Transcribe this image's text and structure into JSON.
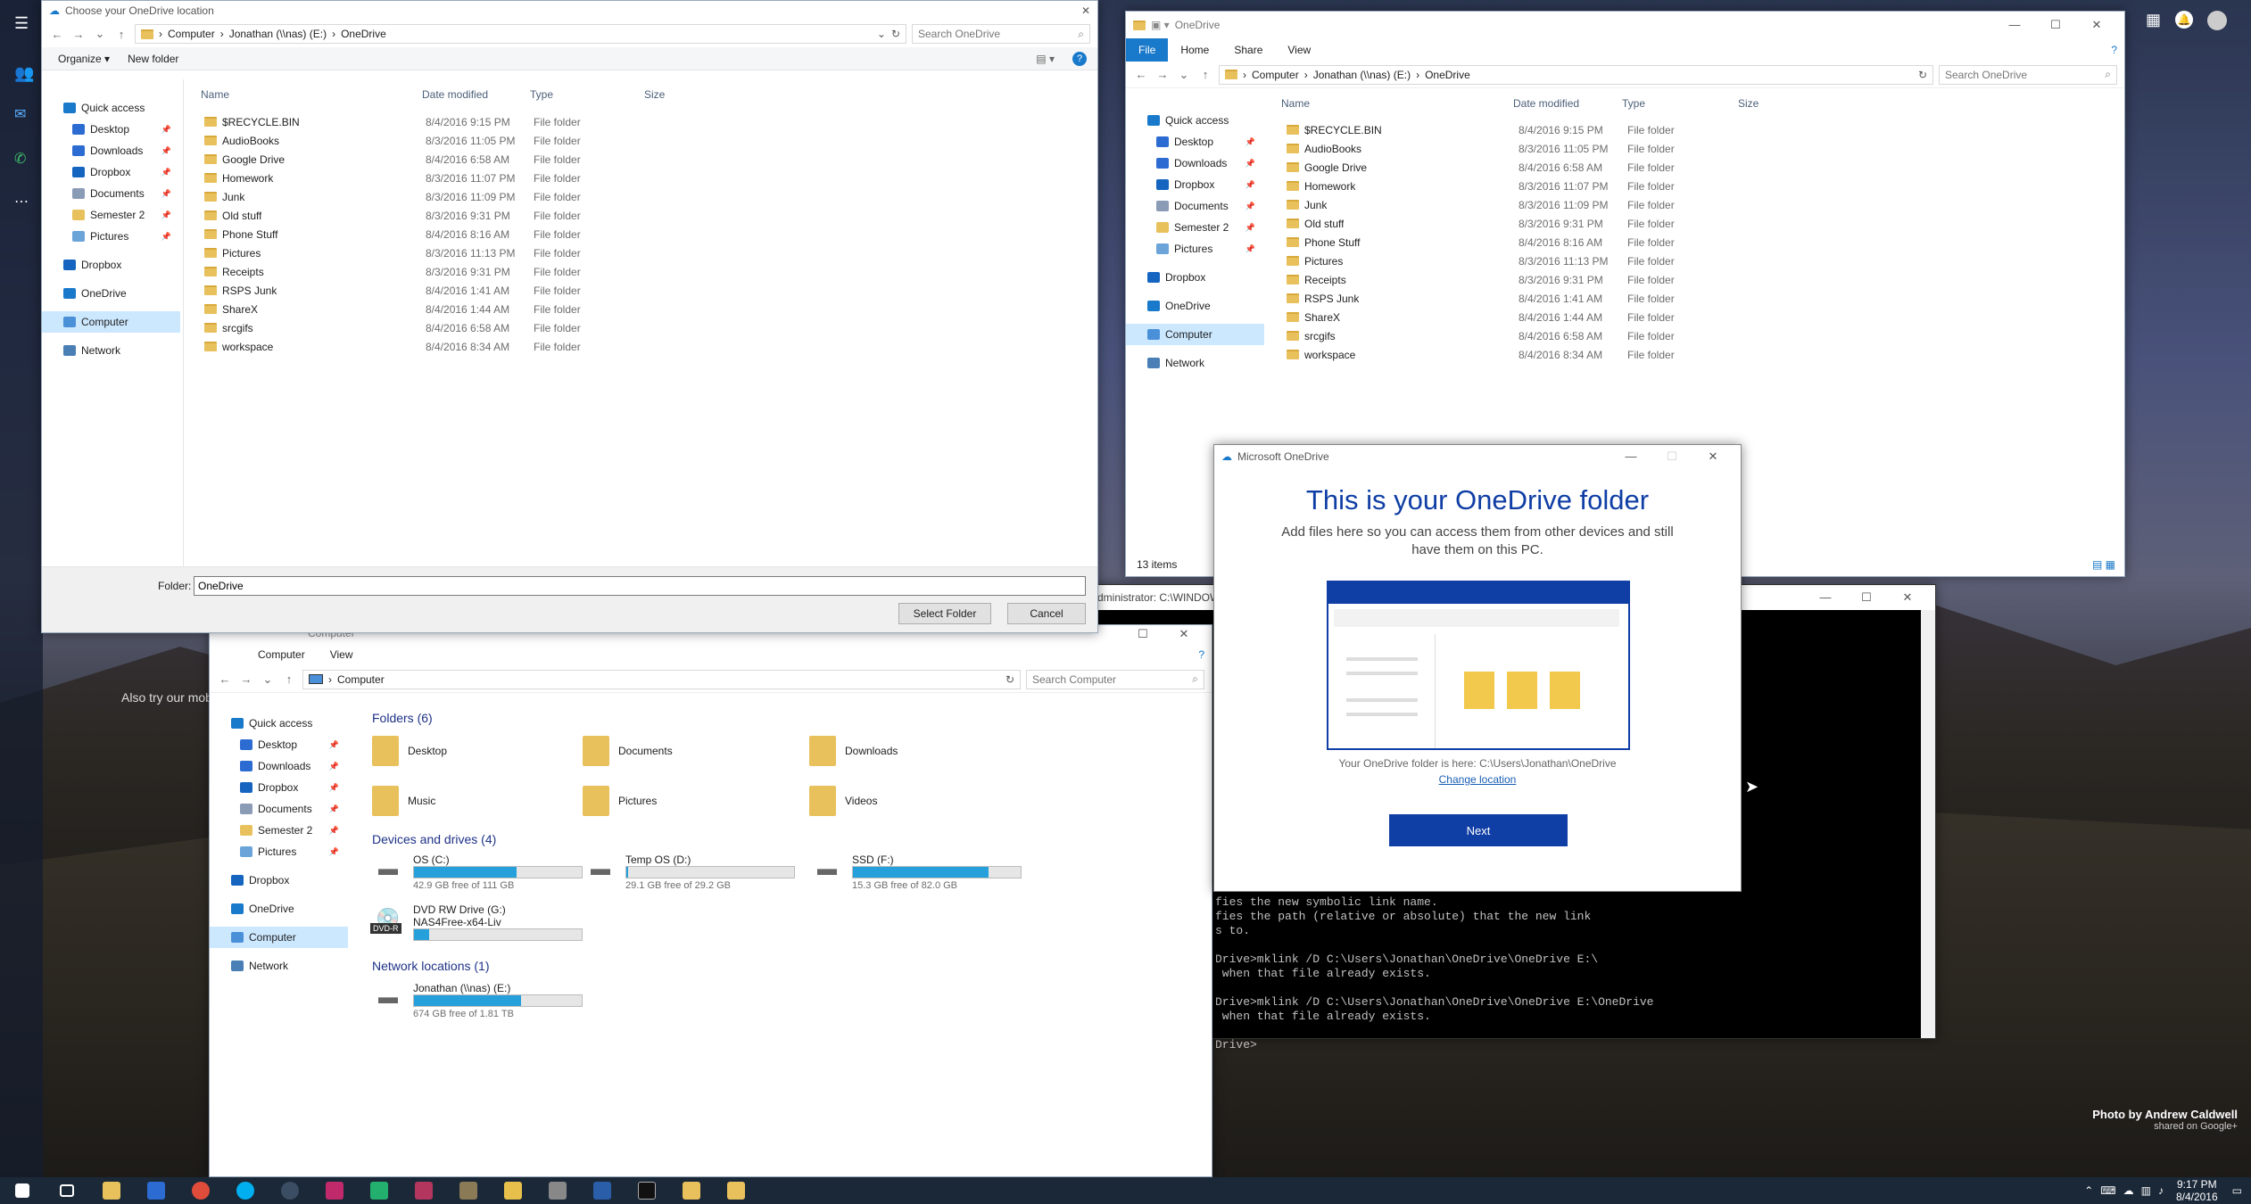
{
  "colors": {
    "accent": "#0078d7",
    "folder": "#e8c15c",
    "progress": "#26a0da",
    "onedrive_blue": "#0f3ea5"
  },
  "photo_credit": {
    "line1": "Photo by Andrew Caldwell",
    "line2": "shared on Google+"
  },
  "bg_text": "Also try our mob",
  "left_rail": {
    "icons": [
      "menu-icon",
      "people-icon",
      "message-icon",
      "phone-icon",
      "more-icon"
    ]
  },
  "top_right": {
    "icons": [
      "apps-grid-icon",
      "notification-icon",
      "avatar"
    ]
  },
  "chooser": {
    "title": "Choose your OneDrive location",
    "close": "✕",
    "breadcrumb": [
      "Computer",
      "Jonathan (\\\\nas) (E:)",
      "OneDrive"
    ],
    "search_placeholder": "Search OneDrive",
    "toolbar": {
      "organize": "Organize",
      "new_folder": "New folder"
    },
    "sidebar": [
      {
        "label": "Quick access",
        "icon": "star-icon",
        "level": 0
      },
      {
        "label": "Desktop",
        "icon": "desktop-icon",
        "level": 1,
        "pin": true
      },
      {
        "label": "Downloads",
        "icon": "download-icon",
        "level": 1,
        "pin": true
      },
      {
        "label": "Dropbox",
        "icon": "dropbox-icon",
        "level": 1,
        "pin": true
      },
      {
        "label": "Documents",
        "icon": "documents-icon",
        "level": 1,
        "pin": true
      },
      {
        "label": "Semester 2",
        "icon": "folder-icon",
        "level": 1,
        "pin": true
      },
      {
        "label": "Pictures",
        "icon": "pictures-icon",
        "level": 1,
        "pin": true
      },
      {
        "label": "Dropbox",
        "icon": "dropbox-icon",
        "level": 0
      },
      {
        "label": "OneDrive",
        "icon": "onedrive-icon",
        "level": 0
      },
      {
        "label": "Computer",
        "icon": "computer-icon",
        "level": 0,
        "selected": true
      },
      {
        "label": "Network",
        "icon": "network-icon",
        "level": 0
      }
    ],
    "columns": [
      "Name",
      "Date modified",
      "Type",
      "Size"
    ],
    "files": [
      {
        "name": "$RECYCLE.BIN",
        "date": "8/4/2016 9:15 PM",
        "type": "File folder"
      },
      {
        "name": "AudioBooks",
        "date": "8/3/2016 11:05 PM",
        "type": "File folder"
      },
      {
        "name": "Google Drive",
        "date": "8/4/2016 6:58 AM",
        "type": "File folder"
      },
      {
        "name": "Homework",
        "date": "8/3/2016 11:07 PM",
        "type": "File folder"
      },
      {
        "name": "Junk",
        "date": "8/3/2016 11:09 PM",
        "type": "File folder"
      },
      {
        "name": "Old stuff",
        "date": "8/3/2016 9:31 PM",
        "type": "File folder"
      },
      {
        "name": "Phone Stuff",
        "date": "8/4/2016 8:16 AM",
        "type": "File folder"
      },
      {
        "name": "Pictures",
        "date": "8/3/2016 11:13 PM",
        "type": "File folder"
      },
      {
        "name": "Receipts",
        "date": "8/3/2016 9:31 PM",
        "type": "File folder"
      },
      {
        "name": "RSPS Junk",
        "date": "8/4/2016 1:41 AM",
        "type": "File folder"
      },
      {
        "name": "ShareX",
        "date": "8/4/2016 1:44 AM",
        "type": "File folder"
      },
      {
        "name": "srcgifs",
        "date": "8/4/2016 6:58 AM",
        "type": "File folder"
      },
      {
        "name": "workspace",
        "date": "8/4/2016 8:34 AM",
        "type": "File folder"
      }
    ],
    "folder_label": "Folder:",
    "folder_value": "OneDrive",
    "select_button": "Select Folder",
    "cancel_button": "Cancel"
  },
  "explorer_onedrive": {
    "title": "OneDrive",
    "ribbon": [
      "File",
      "Home",
      "Share",
      "View"
    ],
    "breadcrumb": [
      "Computer",
      "Jonathan (\\\\nas) (E:)",
      "OneDrive"
    ],
    "search_placeholder": "Search OneDrive",
    "status": "13 items"
  },
  "onedrive_dialog": {
    "title": "Microsoft OneDrive",
    "heading": "This is your OneDrive folder",
    "subtext": "Add files here so you can access them from other devices and still have them on this PC.",
    "path_text": "Your OneDrive folder is here: C:\\Users\\Jonathan\\OneDrive",
    "change_location": "Change location",
    "next_button": "Next"
  },
  "cmd": {
    "title": "Administrator: C:\\WINDOW",
    "lines": [
      "fies the new symbolic link name.",
      "fies the path (relative or absolute) that the new link",
      "s to.",
      "",
      "Drive>mklink /D C:\\Users\\Jonathan\\OneDrive\\OneDrive E:\\",
      " when that file already exists.",
      "",
      "Drive>mklink /D C:\\Users\\Jonathan\\OneDrive\\OneDrive E:\\OneDrive",
      " when that file already exists.",
      "",
      "Drive>"
    ]
  },
  "explorer_computer": {
    "title": "Computer",
    "ribbon": [
      "Computer",
      "View"
    ],
    "breadcrumb": [
      "Computer"
    ],
    "search_placeholder": "Search Computer",
    "sections": {
      "folders": "Folders (6)",
      "drives": "Devices and drives (4)",
      "network": "Network locations (1)"
    },
    "folders": [
      "Desktop",
      "Documents",
      "Downloads",
      "Music",
      "Pictures",
      "Videos"
    ],
    "drives": [
      {
        "name": "OS (C:)",
        "free": "42.9 GB free of 111 GB",
        "used": 0.61
      },
      {
        "name": "Temp OS (D:)",
        "free": "29.1 GB free of 29.2 GB",
        "used": 0.01
      },
      {
        "name": "SSD (F:)",
        "free": "15.3 GB free of 82.0 GB",
        "used": 0.81
      },
      {
        "name": "DVD RW Drive (G:)",
        "sub": "NAS4Free-x64-Liv",
        "badge": "DVD-R",
        "used": 0.09
      }
    ],
    "network": [
      {
        "name": "Jonathan (\\\\nas) (E:)",
        "free": "674 GB free of 1.81 TB",
        "used": 0.64
      }
    ]
  },
  "taskbar": {
    "time": "9:17 PM",
    "date": "8/4/2016"
  }
}
